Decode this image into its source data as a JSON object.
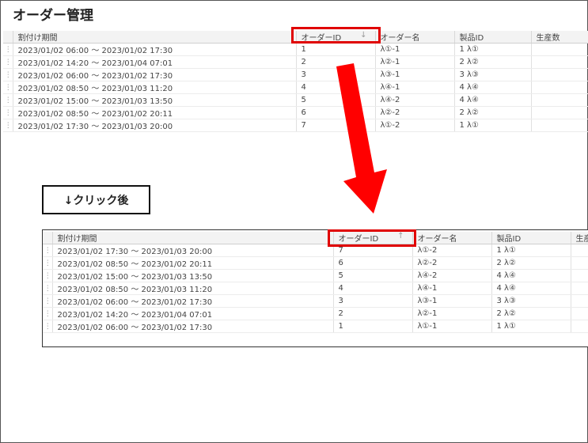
{
  "page": {
    "title": "オーダー管理"
  },
  "columns": {
    "period": "割付け期間",
    "order_id": "オーダーID",
    "order_name": "オーダー名",
    "product_id": "製品ID",
    "quantity": "生産数"
  },
  "sort_icons": {
    "before": "↓",
    "after": "↑"
  },
  "annotation": {
    "after_click": "↓クリック後"
  },
  "colors": {
    "highlight": "#e00000",
    "arrow": "#ff0000"
  },
  "grid_before": {
    "sort": "descending-icon",
    "rows": [
      {
        "period": "2023/01/02 06:00 ～ 2023/01/02 17:30",
        "order_id": "1",
        "order_name": "λ①-1",
        "product_id": "1 λ①",
        "quantity": ""
      },
      {
        "period": "2023/01/02 14:20 ～ 2023/01/04 07:01",
        "order_id": "2",
        "order_name": "λ②-1",
        "product_id": "2 λ②",
        "quantity": ""
      },
      {
        "period": "2023/01/02 06:00 ～ 2023/01/02 17:30",
        "order_id": "3",
        "order_name": "λ③-1",
        "product_id": "3 λ③",
        "quantity": ""
      },
      {
        "period": "2023/01/02 08:50 ～ 2023/01/03 11:20",
        "order_id": "4",
        "order_name": "λ④-1",
        "product_id": "4 λ④",
        "quantity": ""
      },
      {
        "period": "2023/01/02 15:00 ～ 2023/01/03 13:50",
        "order_id": "5",
        "order_name": "λ④-2",
        "product_id": "4 λ④",
        "quantity": ""
      },
      {
        "period": "2023/01/02 08:50 ～ 2023/01/02 20:11",
        "order_id": "6",
        "order_name": "λ②-2",
        "product_id": "2 λ②",
        "quantity": ""
      },
      {
        "period": "2023/01/02 17:30 ～ 2023/01/03 20:00",
        "order_id": "7",
        "order_name": "λ①-2",
        "product_id": "1 λ①",
        "quantity": ""
      }
    ]
  },
  "grid_after": {
    "sort": "ascending-icon",
    "rows": [
      {
        "period": "2023/01/02 17:30 ～ 2023/01/03 20:00",
        "order_id": "7",
        "order_name": "λ①-2",
        "product_id": "1 λ①",
        "quantity": ""
      },
      {
        "period": "2023/01/02 08:50 ～ 2023/01/02 20:11",
        "order_id": "6",
        "order_name": "λ②-2",
        "product_id": "2 λ②",
        "quantity": ""
      },
      {
        "period": "2023/01/02 15:00 ～ 2023/01/03 13:50",
        "order_id": "5",
        "order_name": "λ④-2",
        "product_id": "4 λ④",
        "quantity": ""
      },
      {
        "period": "2023/01/02 08:50 ～ 2023/01/03 11:20",
        "order_id": "4",
        "order_name": "λ④-1",
        "product_id": "4 λ④",
        "quantity": ""
      },
      {
        "period": "2023/01/02 06:00 ～ 2023/01/02 17:30",
        "order_id": "3",
        "order_name": "λ③-1",
        "product_id": "3 λ③",
        "quantity": ""
      },
      {
        "period": "2023/01/02 14:20 ～ 2023/01/04 07:01",
        "order_id": "2",
        "order_name": "λ②-1",
        "product_id": "2 λ②",
        "quantity": ""
      },
      {
        "period": "2023/01/02 06:00 ～ 2023/01/02 17:30",
        "order_id": "1",
        "order_name": "λ①-1",
        "product_id": "1 λ①",
        "quantity": ""
      }
    ]
  }
}
